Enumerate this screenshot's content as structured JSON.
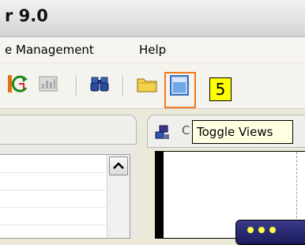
{
  "window": {
    "title": "r 9.0"
  },
  "menubar": {
    "items": [
      "e Management",
      "Help"
    ]
  },
  "toolbar": {
    "buttons": [
      {
        "icon": "refresh-icon",
        "state": "enabled"
      },
      {
        "icon": "chart-icon",
        "state": "disabled"
      },
      {
        "icon": "find-binoculars-icon",
        "state": "enabled"
      },
      {
        "icon": "open-folder-icon",
        "state": "enabled"
      },
      {
        "icon": "toggle-views-icon",
        "state": "highlighted"
      }
    ]
  },
  "callout": {
    "number": "5",
    "highlight_color": "#f07a20",
    "badge_color": "#ffff00"
  },
  "tooltip": {
    "text": "Toggle Views"
  },
  "right_tab": {
    "label": "C"
  }
}
